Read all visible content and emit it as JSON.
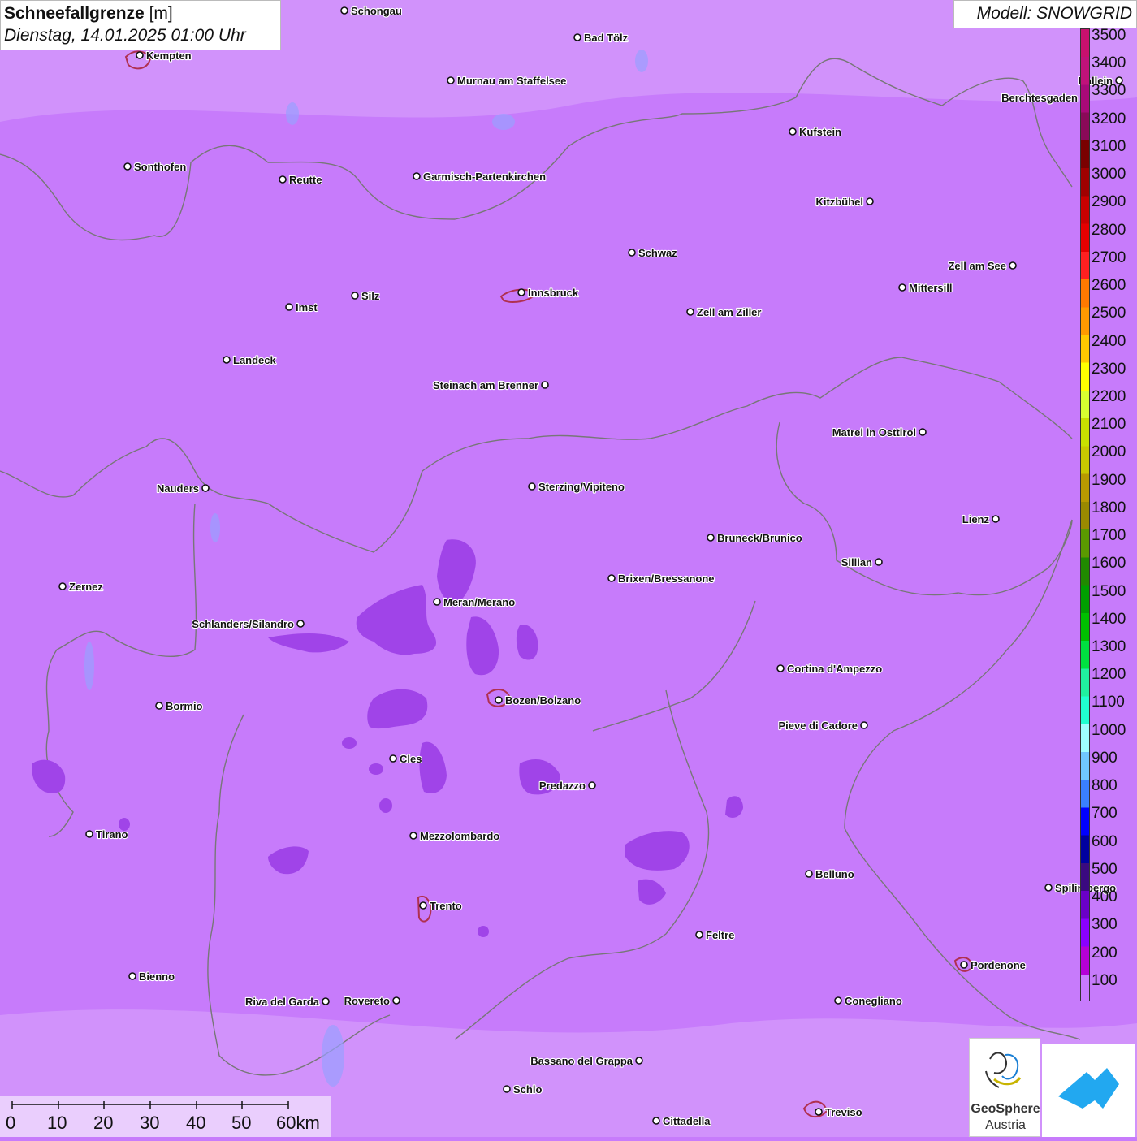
{
  "title": {
    "param": "Schneefallgrenze",
    "unit": "[m]",
    "datetime": "Dienstag, 14.01.2025 01:00 Uhr"
  },
  "model_label": "Modell: SNOWGRID",
  "legend": {
    "labels": [
      "3500",
      "3400",
      "3300",
      "3200",
      "3100",
      "3000",
      "2900",
      "2800",
      "2700",
      "2600",
      "2500",
      "2400",
      "2300",
      "2200",
      "2100",
      "2000",
      "1900",
      "1800",
      "1700",
      "1600",
      "1500",
      "1400",
      "1300",
      "1200",
      "1100",
      "1000",
      "900",
      "800",
      "700",
      "600",
      "500",
      "400",
      "300",
      "200",
      "100"
    ],
    "colors": [
      "#c8106e",
      "#c0127a",
      "#a80a78",
      "#8a0a58",
      "#7a0000",
      "#a00000",
      "#c80000",
      "#e40000",
      "#ff2020",
      "#ff7a00",
      "#ff9a00",
      "#ffc800",
      "#ffff00",
      "#d8ff30",
      "#c8e000",
      "#c8c800",
      "#b89a00",
      "#9a8a00",
      "#5a9a00",
      "#208a00",
      "#00a000",
      "#00c000",
      "#00e040",
      "#20f0a0",
      "#20ffd0",
      "#a0ffff",
      "#70c8ff",
      "#3a80ff",
      "#0000ff",
      "#0000a0",
      "#3a0a80",
      "#6a00c8",
      "#8a00ff",
      "#b400d8",
      "#c87aff"
    ]
  },
  "cities": [
    {
      "name": "Schongau",
      "label": "right"
    },
    {
      "name": "Bad Tölz",
      "label": "right"
    },
    {
      "name": "Kempten",
      "label": "right"
    },
    {
      "name": "Murnau am Staffelsee",
      "label": "right"
    },
    {
      "name": "Berchtesgaden",
      "label": "left"
    },
    {
      "name": "Kufstein",
      "label": "right"
    },
    {
      "name": "Sonthofen",
      "label": "right"
    },
    {
      "name": "Reutte",
      "label": "right"
    },
    {
      "name": "Garmisch-Partenkirchen",
      "label": "right"
    },
    {
      "name": "Kitzbühel",
      "label": "left"
    },
    {
      "name": "Schwaz",
      "label": "right"
    },
    {
      "name": "Zell am See",
      "label": "left"
    },
    {
      "name": "Innsbruck",
      "label": "right"
    },
    {
      "name": "Mittersill",
      "label": "right"
    },
    {
      "name": "Imst",
      "label": "right"
    },
    {
      "name": "Silz",
      "label": "right"
    },
    {
      "name": "Zell am Ziller",
      "label": "right"
    },
    {
      "name": "Landeck",
      "label": "right"
    },
    {
      "name": "Steinach am Brenner",
      "label": "left"
    },
    {
      "name": "Matrei in Osttirol",
      "label": "left"
    },
    {
      "name": "Nauders",
      "label": "left"
    },
    {
      "name": "Sterzing/Vipiteno",
      "label": "right"
    },
    {
      "name": "Lienz",
      "label": "left"
    },
    {
      "name": "Bruneck/Brunico",
      "label": "right"
    },
    {
      "name": "Sillian",
      "label": "left"
    },
    {
      "name": "Zernez",
      "label": "right"
    },
    {
      "name": "Brixen/Bressanone",
      "label": "right"
    },
    {
      "name": "Meran/Merano",
      "label": "right"
    },
    {
      "name": "Schlanders/Silandro",
      "label": "left"
    },
    {
      "name": "Cortina d'Ampezzo",
      "label": "right"
    },
    {
      "name": "Bozen/Bolzano",
      "label": "right"
    },
    {
      "name": "Bormio",
      "label": "right"
    },
    {
      "name": "Pieve di Cadore",
      "label": "left"
    },
    {
      "name": "Cles",
      "label": "right"
    },
    {
      "name": "Predazzo",
      "label": "left"
    },
    {
      "name": "Tirano",
      "label": "right"
    },
    {
      "name": "Mezzolombardo",
      "label": "right"
    },
    {
      "name": "Belluno",
      "label": "right"
    },
    {
      "name": "Spilimbergo",
      "label": "right"
    },
    {
      "name": "Trento",
      "label": "right"
    },
    {
      "name": "Feltre",
      "label": "right"
    },
    {
      "name": "Pordenone",
      "label": "right"
    },
    {
      "name": "Bienno",
      "label": "right"
    },
    {
      "name": "Riva del Garda",
      "label": "left"
    },
    {
      "name": "Rovereto",
      "label": "left"
    },
    {
      "name": "Conegliano",
      "label": "right"
    },
    {
      "name": "Bassano del Grappa",
      "label": "left"
    },
    {
      "name": "Schio",
      "label": "right"
    },
    {
      "name": "Treviso",
      "label": "right"
    },
    {
      "name": "Cittadella",
      "label": "right"
    },
    {
      "name": "Hallein",
      "label": "left"
    }
  ],
  "scale": {
    "ticks": [
      "0",
      "10",
      "20",
      "30",
      "40",
      "50",
      "60km"
    ]
  },
  "logos": {
    "geosphere_line1": "GeoSphere",
    "geosphere_line2": "Austria"
  },
  "colors": {
    "map_background": "#c77bfb",
    "low_snowline_patch": "#a044e8",
    "border_line": "#777777"
  }
}
